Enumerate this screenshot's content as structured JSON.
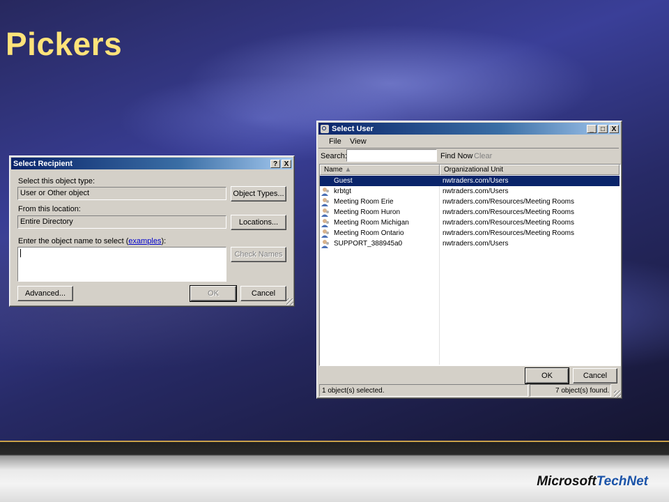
{
  "slide": {
    "title": "Pickers",
    "brand_ms": "Microsoft",
    "brand_tn": "TechNet"
  },
  "recipient": {
    "title": "Select Recipient",
    "help": "?",
    "close": "X",
    "type_label": "Select this object type:",
    "type_value": "User or Other object",
    "object_types_button": "Object Types...",
    "location_label": "From this location:",
    "location_value": "Entire Directory",
    "locations_button": "Locations...",
    "name_label_prefix": "Enter the object name to select (",
    "examples_link": "examples",
    "name_label_suffix": "):",
    "check_names_button": "Check Names",
    "advanced_button": "Advanced...",
    "ok_button": "OK",
    "cancel_button": "Cancel"
  },
  "select_user": {
    "title": "Select User",
    "minimize": "_",
    "maximize": "□",
    "close": "X",
    "menu": [
      {
        "label": "File"
      },
      {
        "label": "View"
      }
    ],
    "search_label": "Search:",
    "search_value": "",
    "find_now": "Find Now",
    "clear": "Clear",
    "columns": {
      "name": "Name",
      "ou": "Organizational Unit"
    },
    "rows": [
      {
        "name": "Guest",
        "ou": "nwtraders.com/Users"
      },
      {
        "name": "krbtgt",
        "ou": "nwtraders.com/Users"
      },
      {
        "name": "Meeting Room Erie",
        "ou": "nwtraders.com/Resources/Meeting Rooms"
      },
      {
        "name": "Meeting Room Huron",
        "ou": "nwtraders.com/Resources/Meeting Rooms"
      },
      {
        "name": "Meeting Room Michigan",
        "ou": "nwtraders.com/Resources/Meeting Rooms"
      },
      {
        "name": "Meeting Room Ontario",
        "ou": "nwtraders.com/Resources/Meeting Rooms"
      },
      {
        "name": "SUPPORT_388945a0",
        "ou": "nwtraders.com/Users"
      }
    ],
    "ok_button": "OK",
    "cancel_button": "Cancel",
    "status_selected": "1 object(s) selected.",
    "status_found": "7 object(s) found."
  },
  "colors": {
    "title_text": "#ffe37a",
    "selection": "#0a246a",
    "titlebar": "#0a246a",
    "accent_line": "#c9a14a",
    "brand_blue": "#1a53a8"
  }
}
